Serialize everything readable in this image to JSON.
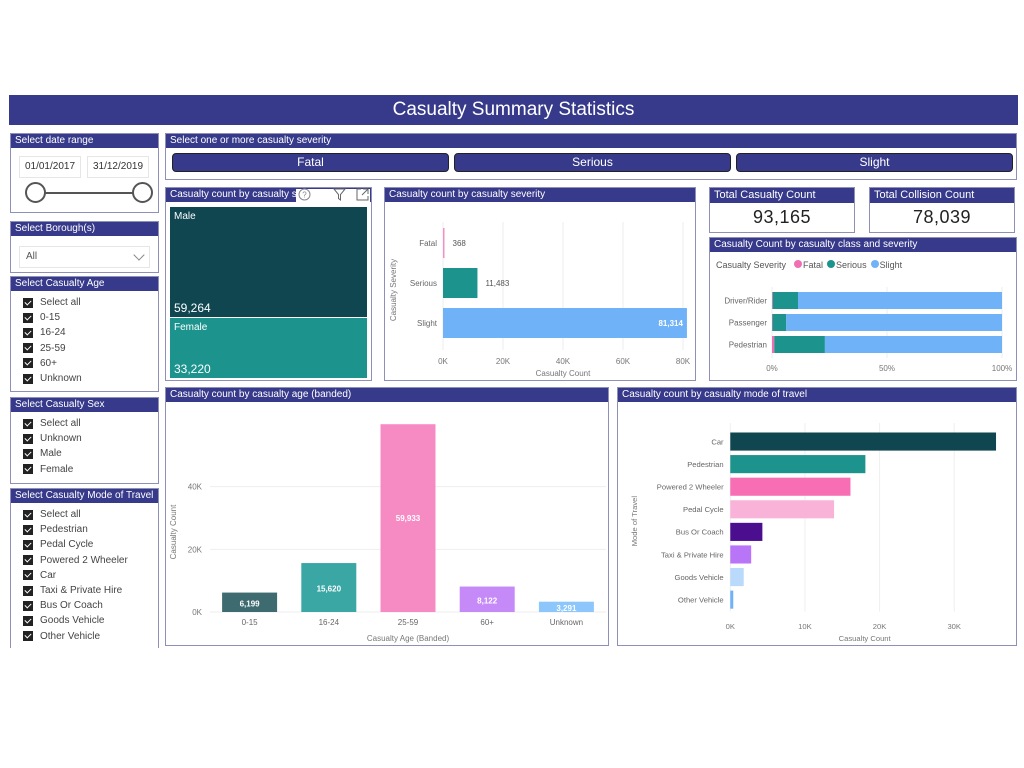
{
  "header": {
    "title": "Casualty Summary Statistics"
  },
  "colors": {
    "header_bg": "#373a8a",
    "male": "#0f4650",
    "female": "#1c938c",
    "fatal": "#f06fb4",
    "serious": "#1c938c",
    "slight": "#6fb2f7"
  },
  "filters": {
    "date_range": {
      "label": "Select date range",
      "start": "01/01/2017",
      "end": "31/12/2019"
    },
    "borough": {
      "label": "Select Borough(s)",
      "value": "All"
    },
    "age": {
      "label": "Select Casualty Age",
      "items": [
        "Select all",
        "0-15",
        "16-24",
        "25-59",
        "60+",
        "Unknown"
      ]
    },
    "sex": {
      "label": "Select Casualty Sex",
      "items": [
        "Select all",
        "Unknown",
        "Male",
        "Female"
      ]
    },
    "mode": {
      "label": "Select Casualty Mode of Travel",
      "items": [
        "Select all",
        "Pedestrian",
        "Pedal Cycle",
        "Powered 2 Wheeler",
        "Car",
        "Taxi & Private Hire",
        "Bus Or Coach",
        "Goods Vehicle",
        "Other Vehicle"
      ]
    }
  },
  "severity_slicer": {
    "label": "Select one or more casualty severity",
    "buttons": [
      "Fatal",
      "Serious",
      "Slight"
    ]
  },
  "kpis": {
    "casualty": {
      "label": "Total Casualty Count",
      "value": "93,165"
    },
    "collision": {
      "label": "Total Collision Count",
      "value": "78,039"
    }
  },
  "treemap": {
    "title": "Casualty count by casualty sex",
    "visible_title": "Casualty count by casualty se",
    "cells": [
      {
        "label": "Male",
        "value_text": "59,264",
        "value": 59264
      },
      {
        "label": "Female",
        "value_text": "33,220",
        "value": 33220
      }
    ]
  },
  "chart_data": [
    {
      "id": "severity",
      "type": "bar",
      "orientation": "horizontal",
      "title": "Casualty count by casualty severity",
      "categories": [
        "Fatal",
        "Serious",
        "Slight"
      ],
      "values": [
        368,
        11483,
        81314
      ],
      "data_labels": [
        "368",
        "11,483",
        "81,314"
      ],
      "xlabel": "Casualty Count",
      "ylabel": "Casualty Severity",
      "xlim": [
        0,
        80000
      ],
      "ticks": [
        "0K",
        "20K",
        "40K",
        "60K",
        "80K"
      ],
      "tick_values": [
        0,
        20000,
        40000,
        60000,
        80000
      ],
      "colors": [
        "#f48fc7",
        "#1c938c",
        "#6fb2f7"
      ]
    },
    {
      "id": "class_severity",
      "type": "bar",
      "orientation": "horizontal",
      "stacked": "100%",
      "title": "Casualty Count by casualty class and severity",
      "legend_title": "Casualty Severity",
      "legend_position": "top-left",
      "categories": [
        "Driver/Rider",
        "Passenger",
        "Pedestrian"
      ],
      "series": [
        {
          "name": "Fatal",
          "values": [
            0.3,
            0.2,
            1.0
          ],
          "color": "#f06fb4"
        },
        {
          "name": "Serious",
          "values": [
            11.0,
            6.0,
            22.0
          ],
          "color": "#1c938c"
        },
        {
          "name": "Slight",
          "values": [
            88.7,
            93.8,
            77.0
          ],
          "color": "#6fb2f7"
        }
      ],
      "xlim": [
        0,
        100
      ],
      "ticks": [
        "0%",
        "50%",
        "100%"
      ],
      "tick_values": [
        0,
        50,
        100
      ]
    },
    {
      "id": "age",
      "type": "bar",
      "orientation": "vertical",
      "title": "Casualty count by casualty age (banded)",
      "categories": [
        "0-15",
        "16-24",
        "25-59",
        "60+",
        "Unknown"
      ],
      "values": [
        6199,
        15620,
        59933,
        8122,
        3291
      ],
      "data_labels": [
        "6,199",
        "15,620",
        "59,933",
        "8,122",
        "3,291"
      ],
      "xlabel": "Casualty Age (Banded)",
      "ylabel": "Casualty Count",
      "ylim": [
        0,
        60000
      ],
      "ticks": [
        "0K",
        "20K",
        "40K"
      ],
      "tick_values": [
        0,
        20000,
        40000
      ],
      "colors": [
        "#3d6b6f",
        "#3aa7a5",
        "#f68bc4",
        "#c58af8",
        "#8cc6fb"
      ]
    },
    {
      "id": "mode",
      "type": "bar",
      "orientation": "horizontal",
      "title": "Casualty count by casualty mode of travel",
      "categories": [
        "Car",
        "Pedestrian",
        "Powered 2 Wheeler",
        "Pedal Cycle",
        "Bus Or Coach",
        "Taxi & Private Hire",
        "Goods Vehicle",
        "Other Vehicle"
      ],
      "values": [
        35600,
        18100,
        16100,
        13900,
        4300,
        2800,
        1800,
        400
      ],
      "xlabel": "Casualty Count",
      "ylabel": "Mode of Travel",
      "xlim": [
        0,
        36000
      ],
      "ticks": [
        "0K",
        "10K",
        "20K",
        "30K"
      ],
      "tick_values": [
        0,
        10000,
        20000,
        30000
      ],
      "colors": [
        "#0f4650",
        "#1c938c",
        "#f86eb4",
        "#f9b3d8",
        "#4a0e8f",
        "#b875f8",
        "#b9dafb",
        "#6fb2f7"
      ]
    }
  ]
}
